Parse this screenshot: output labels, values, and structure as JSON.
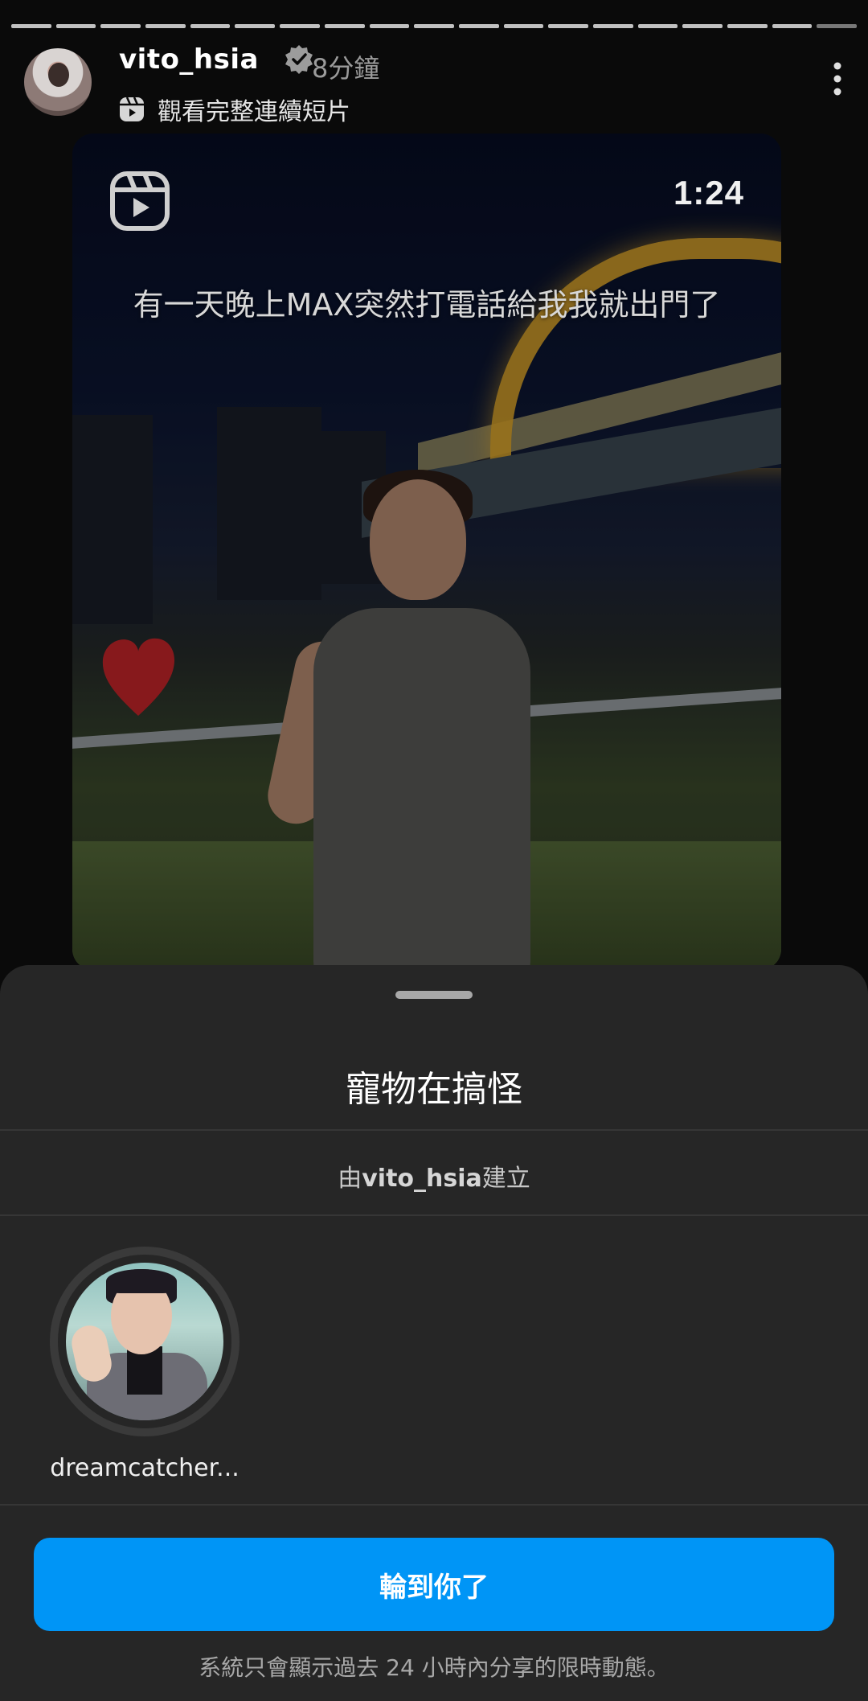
{
  "story": {
    "progress_segments": 19,
    "progress_done": 18,
    "username": "vito_hsia",
    "time_ago": "8分鐘",
    "reel_link_label": "觀看完整連續短片",
    "icons": {
      "verified": "verified-badge-icon",
      "reel": "reels-icon",
      "more": "more-vertical-icon"
    }
  },
  "reel_preview": {
    "duration": "1:24",
    "caption": "有一天晚上MAX突然打電話給我我就出門了",
    "icons": {
      "reel_logo": "reels-icon",
      "sticker": "heart-sticker"
    }
  },
  "sheet": {
    "title": "寵物在搞怪",
    "created_by_prefix": "由",
    "creator": "vito_hsia",
    "created_by_suffix": "建立",
    "participants": [
      {
        "name": "dreamcatcher..."
      }
    ],
    "cta_label": "輪到你了",
    "footer_note": "系統只會顯示過去 24 小時內分享的限時動態。"
  },
  "colors": {
    "sheet_bg": "#262626",
    "cta_blue": "#0095f6",
    "muted_text": "#a8a8a8"
  }
}
